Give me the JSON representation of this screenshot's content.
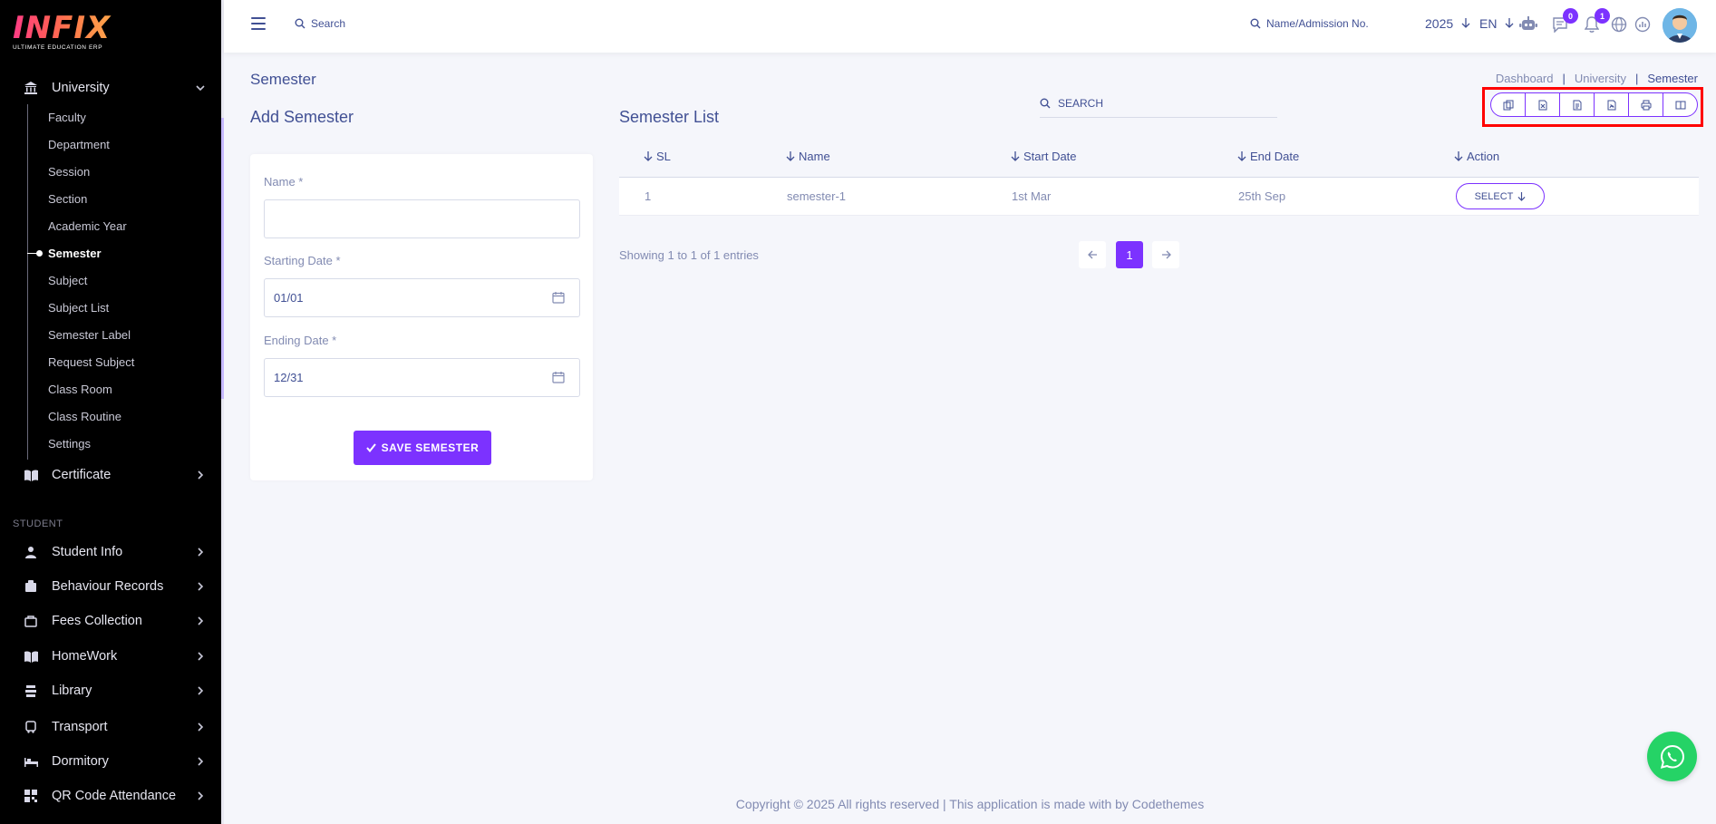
{
  "brand": {
    "logo_text": "INFIX",
    "logo_subtitle": "ULTIMATE EDUCATION ERP",
    "gradient": [
      "#ff3c86",
      "#ffa64a"
    ]
  },
  "colors": {
    "accent": "#7c32ff",
    "text": "#415094",
    "muted": "#828bb2",
    "highlight_box": "#ff0000",
    "whatsapp": "#25d366"
  },
  "sidebar": {
    "university": {
      "label": "University",
      "icon": "bank-icon"
    },
    "submenu": [
      "Faculty",
      "Department",
      "Session",
      "Section",
      "Academic Year",
      "Semester",
      "Subject",
      "Subject List",
      "Semester Label",
      "Request Subject",
      "Class Room",
      "Class Routine",
      "Settings"
    ],
    "active_submenu": "Semester",
    "certificate": {
      "label": "Certificate",
      "icon": "book-icon"
    },
    "section_label": "STUDENT",
    "items": [
      {
        "label": "Student Info",
        "icon": "user-icon"
      },
      {
        "label": "Behaviour Records",
        "icon": "records-icon"
      },
      {
        "label": "Fees Collection",
        "icon": "fees-icon"
      },
      {
        "label": "HomeWork",
        "icon": "book-icon"
      },
      {
        "label": "Library",
        "icon": "library-icon"
      },
      {
        "label": "Transport",
        "icon": "bus-icon"
      },
      {
        "label": "Dormitory",
        "icon": "bed-icon"
      },
      {
        "label": "QR Code Attendance",
        "icon": "qr-icon"
      }
    ]
  },
  "header": {
    "search_placeholder": "Search",
    "admission_search": "Name/Admission No.",
    "year": "2025",
    "language": "EN",
    "chat_badge": "0",
    "notification_badge": "1"
  },
  "page": {
    "title": "Semester",
    "breadcrumb": [
      "Dashboard",
      "University",
      "Semester"
    ],
    "breadcrumb_sep": "|"
  },
  "form": {
    "title": "Add Semester",
    "name_label": "Name *",
    "name_value": "",
    "start_label": "Starting Date *",
    "start_value": "01/01",
    "end_label": "Ending Date *",
    "end_value": "12/31",
    "save_label": "SAVE SEMESTER"
  },
  "list": {
    "title": "Semester List",
    "search_placeholder": "SEARCH",
    "columns": [
      "SL",
      "Name",
      "Start Date",
      "End Date",
      "Action"
    ],
    "rows": [
      {
        "sl": "1",
        "name": "semester-1",
        "start": "1st Mar",
        "end": "25th Sep",
        "action": "SELECT"
      }
    ],
    "showing": "Showing 1 to 1 of 1 entries",
    "current_page": "1",
    "export_buttons": [
      "copy-icon",
      "excel-icon",
      "csv-icon",
      "pdf-icon",
      "print-icon",
      "columns-icon"
    ]
  },
  "footer": {
    "text": "Copyright © 2025 All rights reserved | This application is made with by Codethemes"
  }
}
